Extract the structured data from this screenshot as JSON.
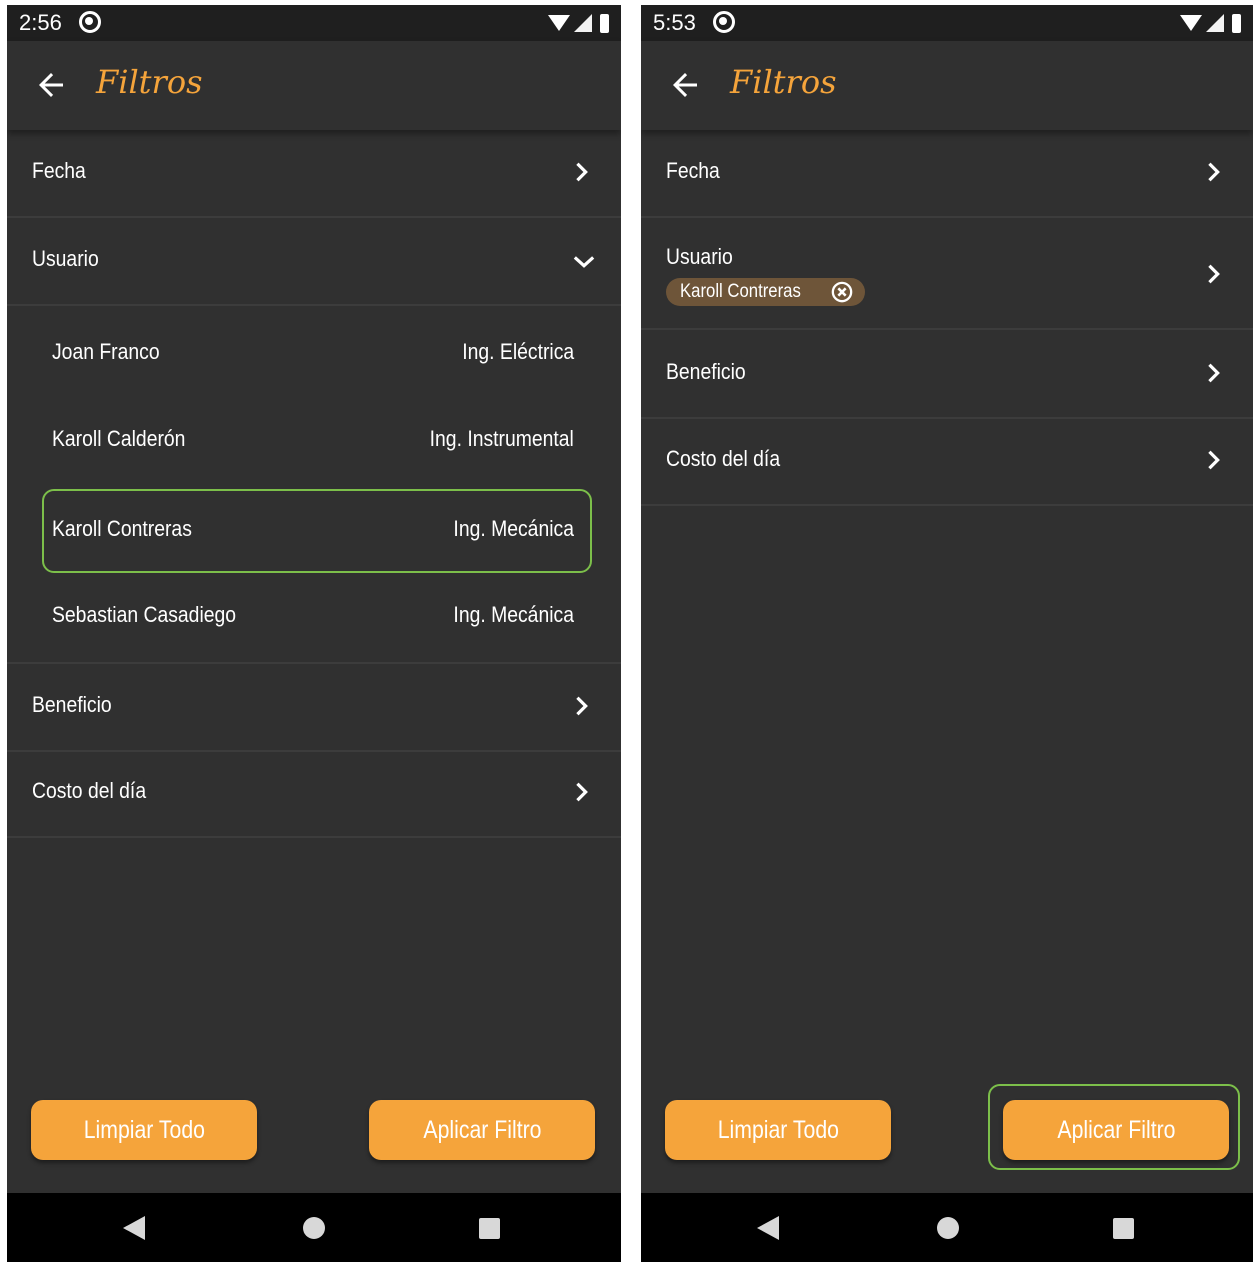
{
  "colors": {
    "accent": "#f5a43b",
    "background": "#303030",
    "status_bar": "#1f1f1f",
    "divider": "#3c3c3c",
    "highlight": "#7cbf4a",
    "chip": "#6e5539",
    "text": "#ffffff"
  },
  "screens": [
    {
      "status_time": "2:56",
      "title": "Filtros",
      "rows": {
        "fecha": "Fecha",
        "usuario": "Usuario",
        "beneficio": "Beneficio",
        "costo": "Costo del día"
      },
      "users": [
        {
          "name": "Joan Franco",
          "dept": "Ing. Eléctrica"
        },
        {
          "name": "Karoll Calderón",
          "dept": "Ing. Instrumental"
        },
        {
          "name": "Karoll Contreras",
          "dept": "Ing. Mecánica"
        },
        {
          "name": "Sebastian Casadiego",
          "dept": "Ing. Mecánica"
        }
      ],
      "buttons": {
        "clear": "Limpiar Todo",
        "apply": "Aplicar Filtro"
      }
    },
    {
      "status_time": "5:53",
      "title": "Filtros",
      "rows": {
        "fecha": "Fecha",
        "usuario": "Usuario",
        "beneficio": "Beneficio",
        "costo": "Costo del día"
      },
      "selected_user_chip": "Karoll Contreras",
      "buttons": {
        "clear": "Limpiar Todo",
        "apply": "Aplicar Filtro"
      }
    }
  ]
}
